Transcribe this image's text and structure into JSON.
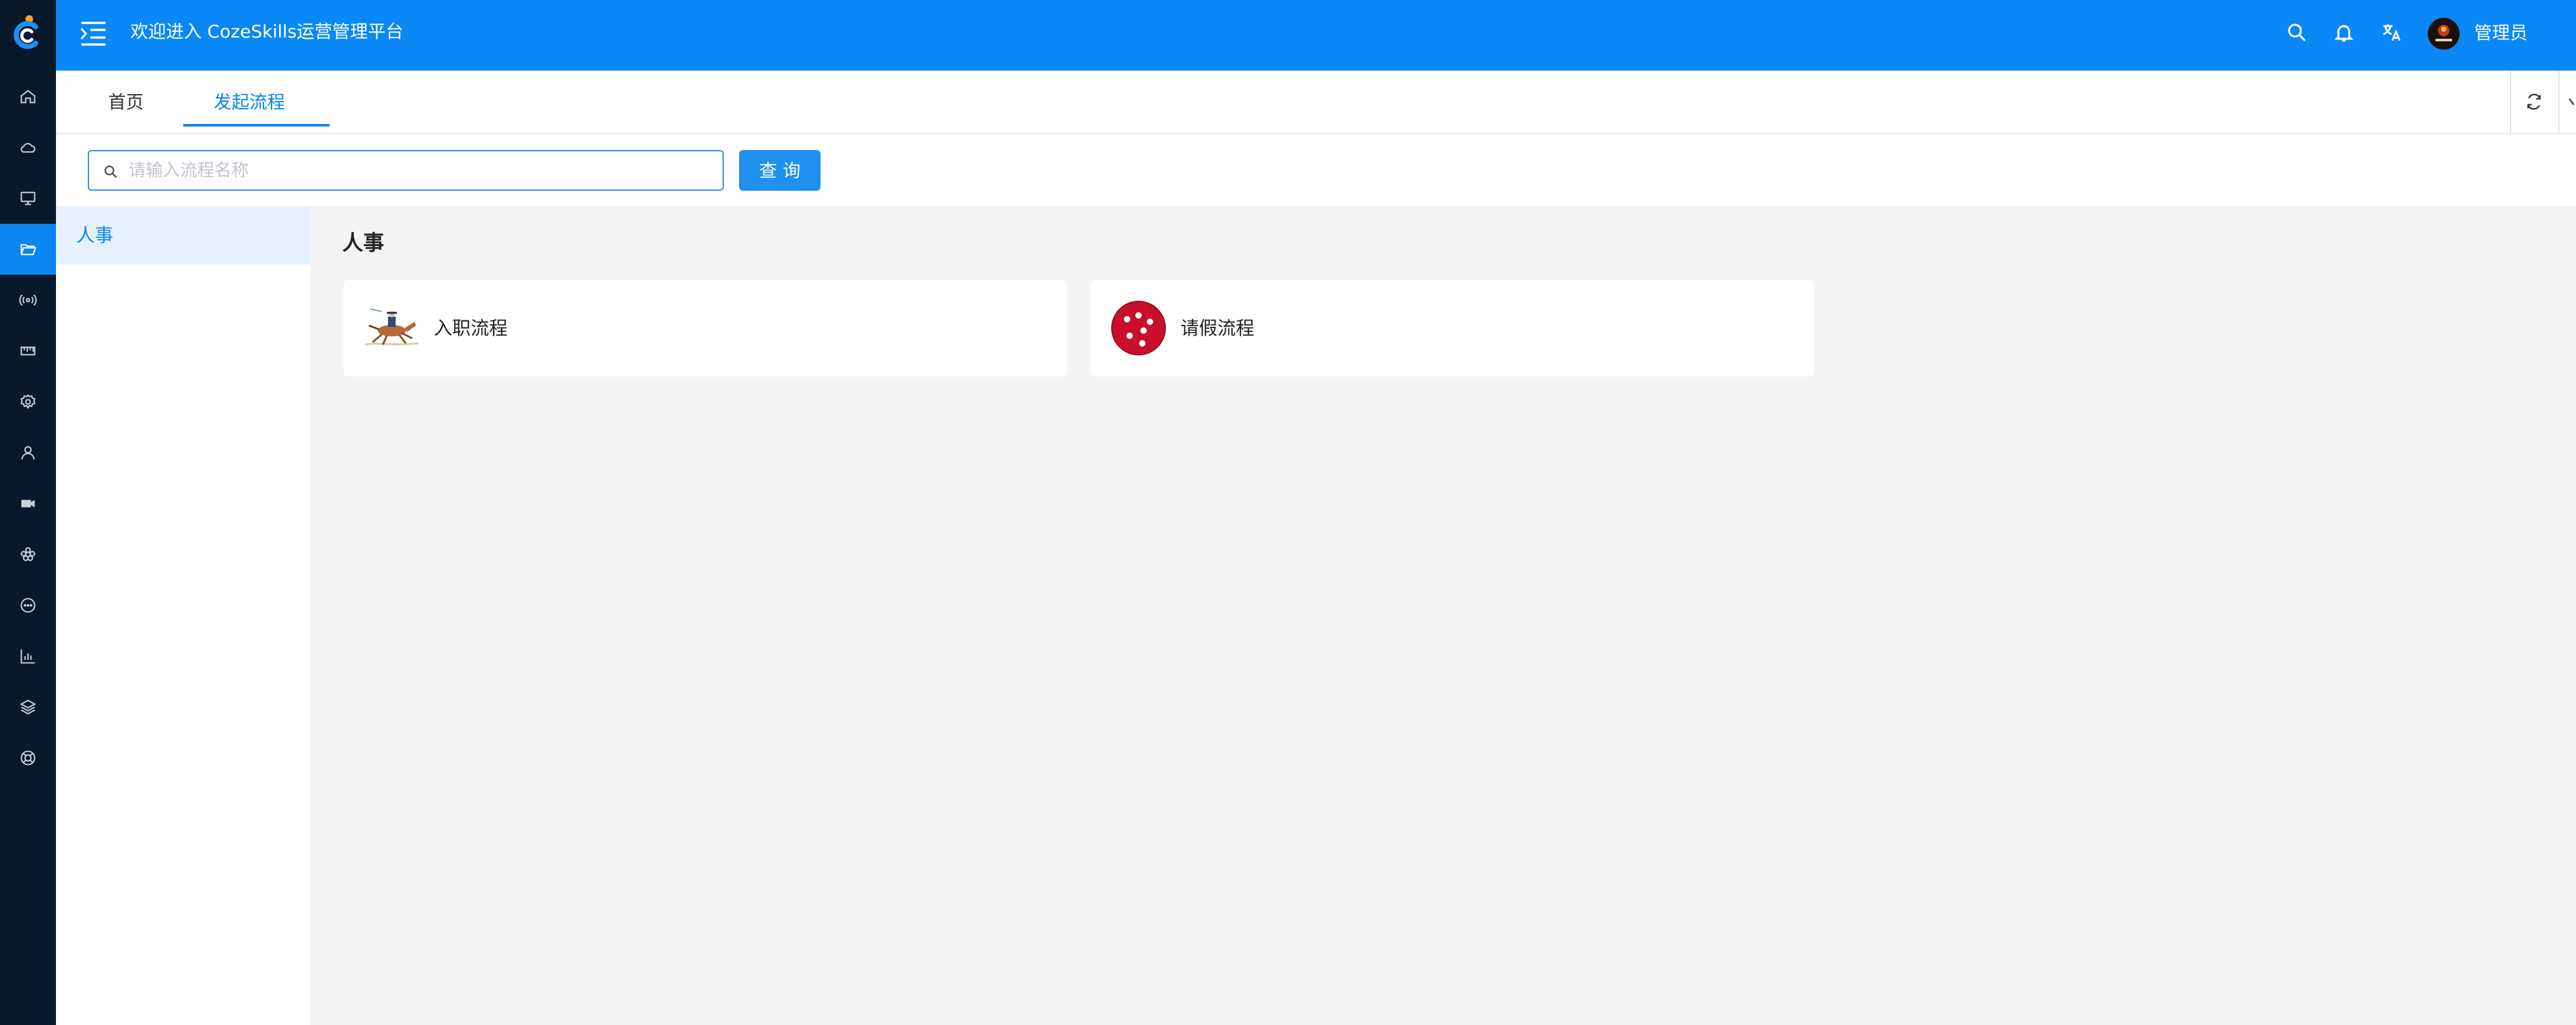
{
  "header": {
    "title": "欢迎进入 CozeSkills运营管理平台",
    "user_name": "管理员",
    "icons": [
      "menu-toggle-icon",
      "search-icon",
      "bell-icon",
      "translate-icon",
      "settings-icon"
    ]
  },
  "sidebar": {
    "items": [
      {
        "icon": "home-icon"
      },
      {
        "icon": "cloud-icon"
      },
      {
        "icon": "monitor-icon"
      },
      {
        "icon": "folder-open-icon",
        "active": true
      },
      {
        "icon": "broadcast-icon"
      },
      {
        "icon": "ruler-icon"
      },
      {
        "icon": "gear-icon"
      },
      {
        "icon": "user-icon"
      },
      {
        "icon": "video-icon"
      },
      {
        "icon": "flower-icon"
      },
      {
        "icon": "chat-icon"
      },
      {
        "icon": "chart-icon"
      },
      {
        "icon": "layers-icon"
      },
      {
        "icon": "lifebuoy-icon"
      }
    ]
  },
  "tabs": [
    {
      "label": "首页",
      "active": false
    },
    {
      "label": "发起流程",
      "active": true
    }
  ],
  "search": {
    "placeholder": "请输入流程名称",
    "value": "",
    "button_label": "查 询"
  },
  "categories": [
    {
      "label": "人事",
      "active": true
    }
  ],
  "main": {
    "section_title": "人事",
    "cards": [
      {
        "label": "入职流程",
        "icon": "horse-rider-image"
      },
      {
        "label": "请假流程",
        "icon": "red-dice-image"
      }
    ]
  },
  "colors": {
    "header_bg": "#0a88f5",
    "sidebar_bg": "#07192b",
    "accent": "#0a85f2",
    "content_bg": "#f4f4f4"
  }
}
